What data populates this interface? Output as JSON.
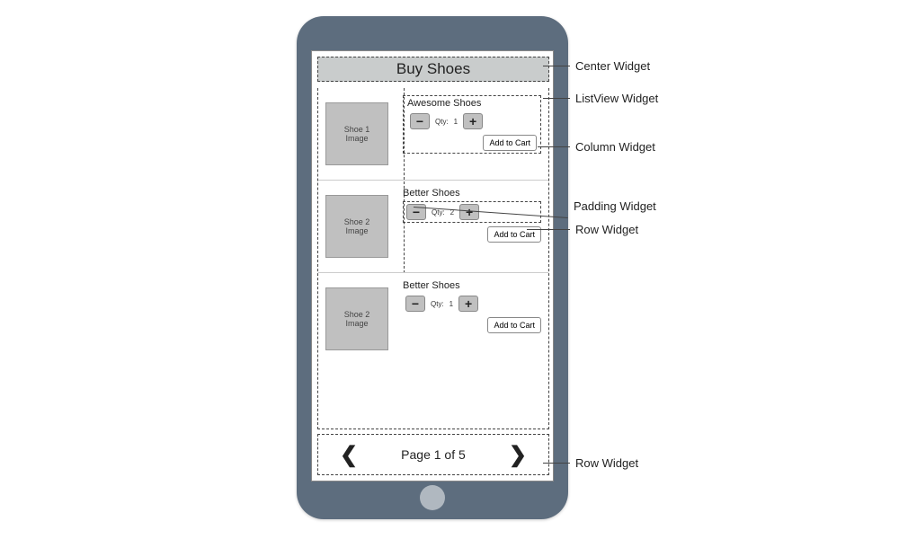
{
  "header": {
    "title": "Buy Shoes"
  },
  "items": [
    {
      "image_label": "Shoe 1\nImage",
      "title": "Awesome Shoes",
      "qty_label": "Qty:",
      "qty": "1",
      "add_label": "Add to Cart"
    },
    {
      "image_label": "Shoe 2\nImage",
      "title": "Better Shoes",
      "qty_label": "Qty:",
      "qty": "2",
      "add_label": "Add to Cart"
    },
    {
      "image_label": "Shoe 2\nImage",
      "title": "Better Shoes",
      "qty_label": "Qty:",
      "qty": "1",
      "add_label": "Add to Cart"
    }
  ],
  "pagination": {
    "text": "Page 1 of 5"
  },
  "annotations": {
    "center": "Center Widget",
    "listview": "ListView Widget",
    "column": "Column Widget",
    "padding": "Padding Widget",
    "row": "Row Widget",
    "row2": "Row Widget"
  }
}
